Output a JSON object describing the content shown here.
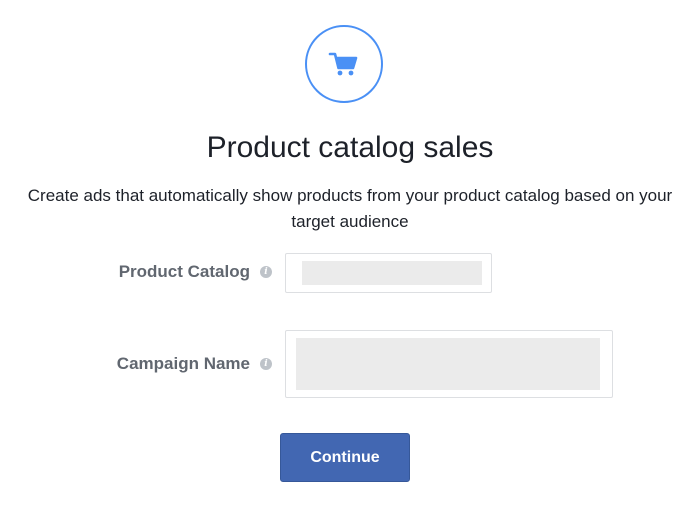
{
  "header": {
    "icon": "shopping-cart-icon",
    "title": "Product catalog sales",
    "description": "Create ads that automatically show products from your product catalog based on your target audience"
  },
  "form": {
    "product_catalog": {
      "label": "Product Catalog",
      "info_icon": "info-icon",
      "value": ""
    },
    "campaign_name": {
      "label": "Campaign Name",
      "info_icon": "info-icon",
      "value": ""
    }
  },
  "actions": {
    "continue_label": "Continue"
  },
  "colors": {
    "accent": "#4a90f5",
    "button": "#4267b2",
    "label": "#616770",
    "field_fill": "#ebebeb"
  }
}
